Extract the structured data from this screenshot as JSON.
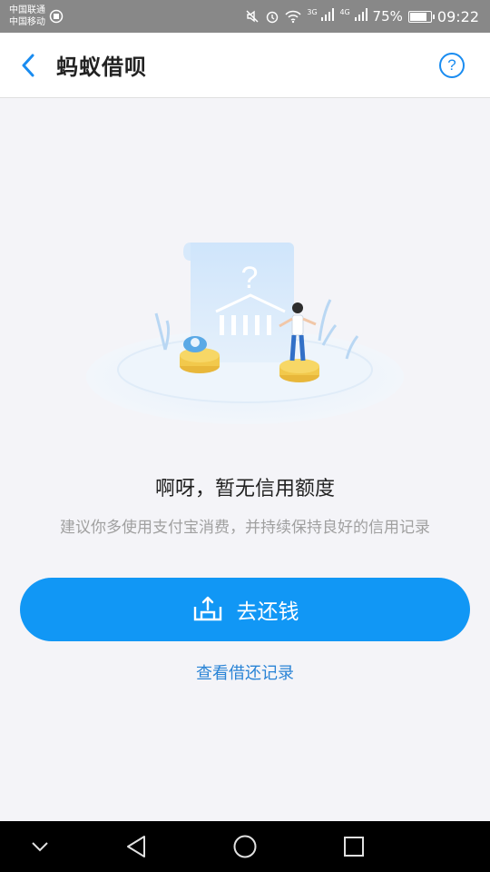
{
  "status_bar": {
    "carrier_1": "中国联通",
    "carrier_2": "中国移动",
    "network_1": "3G",
    "network_2": "4G",
    "battery": "75%",
    "time": "09:22"
  },
  "header": {
    "title": "蚂蚁借呗",
    "help_label": "?"
  },
  "empty_state": {
    "title": "啊呀，暂无信用额度",
    "subtitle": "建议你多使用支付宝消费，并持续保持良好的信用记录"
  },
  "actions": {
    "repay_label": "去还钱",
    "records_link": "查看借还记录"
  },
  "colors": {
    "accent": "#1197f5",
    "link": "#2a84d6",
    "status_bar": "#888888"
  },
  "icons": {
    "back": "chevron-left-icon",
    "help": "question-circle-icon",
    "repay": "repay-tray-icon",
    "nav_collapse": "chevron-down-icon",
    "nav_back": "triangle-back-icon",
    "nav_home": "circle-home-icon",
    "nav_recent": "square-recent-icon"
  }
}
